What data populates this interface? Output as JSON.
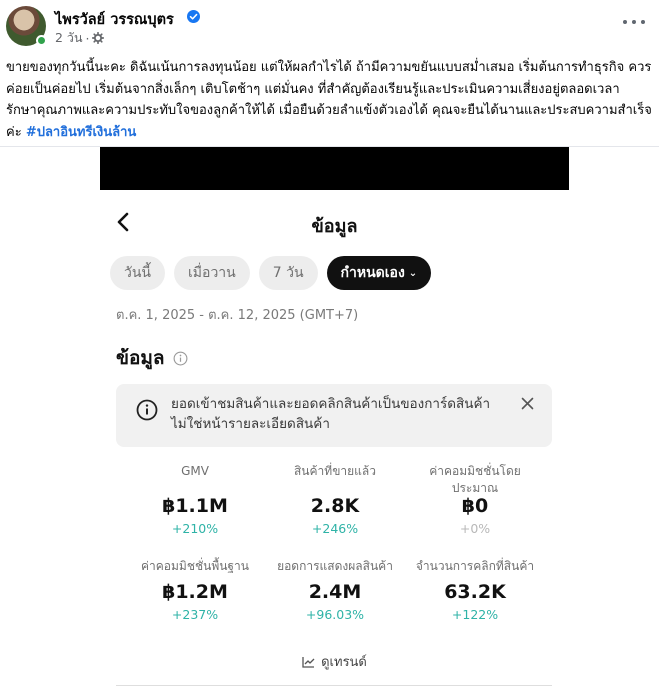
{
  "post": {
    "author": "ไพรวัลย์ วรรณบุตร",
    "time": "2 วัน",
    "meta_separator": "·",
    "text": "ขายของทุกวันนี้นะคะ ดิฉันเน้นการลงทุนน้อย แต่ให้ผลกำไรได้ ถ้ามีความขยันแบบสม่ำเสมอ  เริ่มต้นการทำธุรกิจ ควรค่อยเป็นค่อยไป เริ่มต้นจากสิ่งเล็กๆ เติบโตช้าๆ แต่มั่นคง ที่สำคัญต้องเรียนรู้และประเมินความเสี่ยงอยู่ตลอดเวลา รักษาคุณภาพและความประทับใจของลูกค้าให้ได้ เมื่อยืนด้วยลำแข้งตัวเองได้ คุณจะยืนได้นานและประสบความสำเร็จค่ะ ",
    "hashtag": "#ปลาอินทรีเงินล้าน"
  },
  "screenshot": {
    "title": "ข้อมูล",
    "chips": [
      {
        "label": "วันนี้"
      },
      {
        "label": "เมื่อวาน"
      },
      {
        "label": "7 วัน"
      },
      {
        "label": "กำหนดเอง",
        "caret": "⌄"
      }
    ],
    "date_range": "ต.ค. 1, 2025 - ต.ค. 12, 2025 (GMT+7)",
    "section_title": "ข้อมูล",
    "notice": "ยอดเข้าชมสินค้าและยอดคลิกสินค้าเป็นของการ์ดสินค้า ไม่ใช่หน้ารายละเอียดสินค้า",
    "metrics": [
      {
        "label": "GMV",
        "value": "฿1.1M",
        "change": "+210%"
      },
      {
        "label": "สินค้าที่ขายแล้ว",
        "value": "2.8K",
        "change": "+246%"
      },
      {
        "label": "ค่าคอมมิชชั่นโดยประมาณ",
        "value": "฿0",
        "change": "+0%"
      },
      {
        "label": "ค่าคอมมิชชั่นพื้นฐาน",
        "value": "฿1.2M",
        "change": "+237%"
      },
      {
        "label": "ยอดการแสดงผลสินค้า",
        "value": "2.4M",
        "change": "+96.03%"
      },
      {
        "label": "จำนวนการคลิกที่สินค้า",
        "value": "63.2K",
        "change": "+122%"
      }
    ],
    "trend_link": "ดูเทรนด์"
  },
  "colors": {
    "positive": "#2fb3a7",
    "neutral": "#b8b8b8",
    "hashtag": "#216fdb",
    "verified": "#1877f2"
  }
}
